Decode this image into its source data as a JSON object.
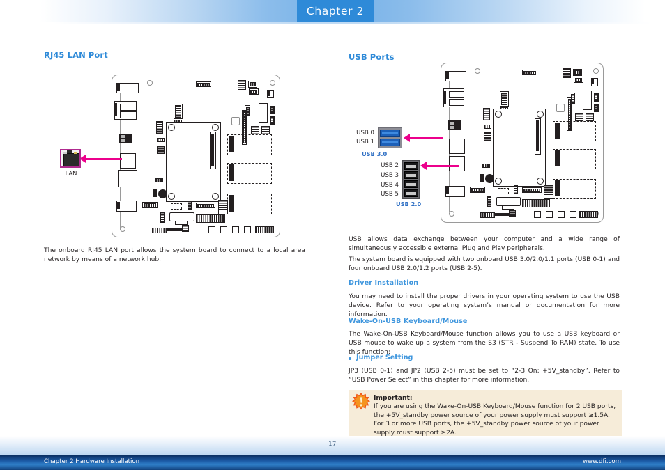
{
  "header": {
    "chapter_tab": "Chapter 2"
  },
  "left": {
    "heading": "RJ45 LAN Port",
    "connector_label": "LAN",
    "paragraph": "The onboard RJ45 LAN port allows the system board to connect to a local area network by means of a network hub."
  },
  "right": {
    "heading": "USB Ports",
    "usb3_ports": [
      "USB 0",
      "USB 1"
    ],
    "usb3_caption": "USB 3.0",
    "usb2_ports": [
      "USB 2",
      "USB 3",
      "USB 4",
      "USB 5"
    ],
    "usb2_caption": "USB 2.0",
    "paragraph1": "USB allows data exchange between your computer and a wide range of simultaneously accessible external Plug and Play peripherals.",
    "paragraph2": "The system board is equipped with two onboard USB 3.0/2.0/1.1 ports (USB 0-1) and four onboard USB 2.0/1.2 ports (USB 2-5).",
    "driver_heading": "Driver Installation",
    "driver_text": "You may need to install the proper drivers in your operating system to use the USB device. Refer to your operating system’s manual or documentation for more information.",
    "wake_heading": "Wake-On-USB Keyboard/Mouse",
    "wake_text": "The Wake-On-USB Keyboard/Mouse function allows you to use a USB keyboard or USB mouse to wake up a system from the S3 (STR - Suspend To RAM) state. To use this function:",
    "jumper_bullet": "Jumper Setting",
    "jumper_text": "JP3 (USB 0-1) and JP2 (USB 2-5) must be set to “2-3 On: +5V_standby”. Refer to “USB Power Select” in this chapter for more information."
  },
  "callout": {
    "title": "Important:",
    "text": "If you are using the Wake-On-USB Keyboard/Mouse function for 2 USB ports, the +5V_standby power source of your power supply must support ≥1.5A. For 3 or more USB ports, the +5V_standby power source of your power supply must support ≥2A."
  },
  "footer": {
    "page_number": "17",
    "left_text": "Chapter 2 Hardware Installation",
    "right_text": "www.dfi.com"
  },
  "colors": {
    "accent_blue": "#2e8ad8",
    "heading_blue": "#3d95dd",
    "arrow_magenta": "#ec008c",
    "highlight_purple": "#b02a8f",
    "callout_bg": "#f6ecd9",
    "callout_rule": "#f0a32b",
    "footer_bar": "#1c5ba6"
  }
}
